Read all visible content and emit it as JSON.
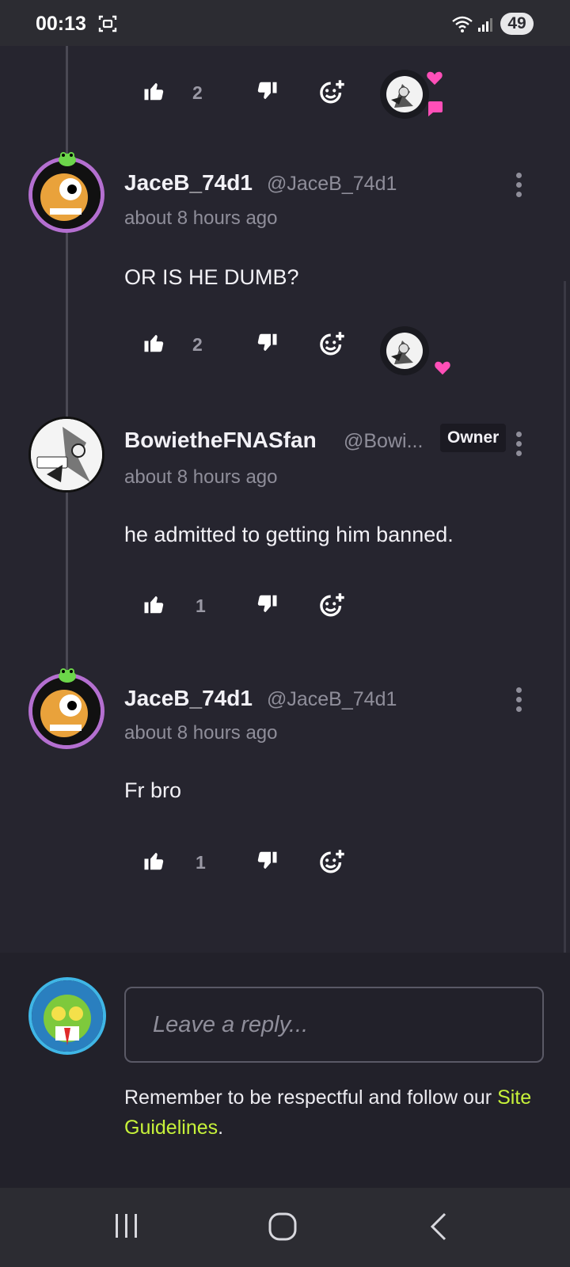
{
  "status_bar": {
    "time": "00:13",
    "battery": "49"
  },
  "comments": [
    {
      "username": "JaceB_74d1",
      "handle": "@JaceB_74d1",
      "time": "about 8 hours ago",
      "text": "OR IS HE DUMB?",
      "likes": "2"
    },
    {
      "username": "BowietheFNASfan",
      "handle": "@Bowi...",
      "badge": "Owner",
      "time": "about 8 hours ago",
      "text": "he admitted to getting him banned.",
      "likes": "1"
    },
    {
      "username": "JaceB_74d1",
      "handle": "@JaceB_74d1",
      "time": "about 8 hours ago",
      "text": "Fr bro",
      "likes": "1"
    }
  ],
  "top_actions": {
    "likes": "2"
  },
  "reply": {
    "placeholder": "Leave a reply...",
    "notice": "Remember to be respectful and follow our ",
    "link": "Site Guidelines",
    "period": "."
  },
  "colors": {
    "background": "#26252f",
    "link": "#c7f23a",
    "reaction_heart": "#ff4fb8"
  },
  "icons": [
    "screen-record-icon",
    "wifi-icon",
    "signal-icon",
    "thumbs-up-icon",
    "thumbs-down-icon",
    "add-reaction-icon",
    "more-options-icon",
    "recent-apps-icon",
    "home-icon",
    "back-icon"
  ]
}
